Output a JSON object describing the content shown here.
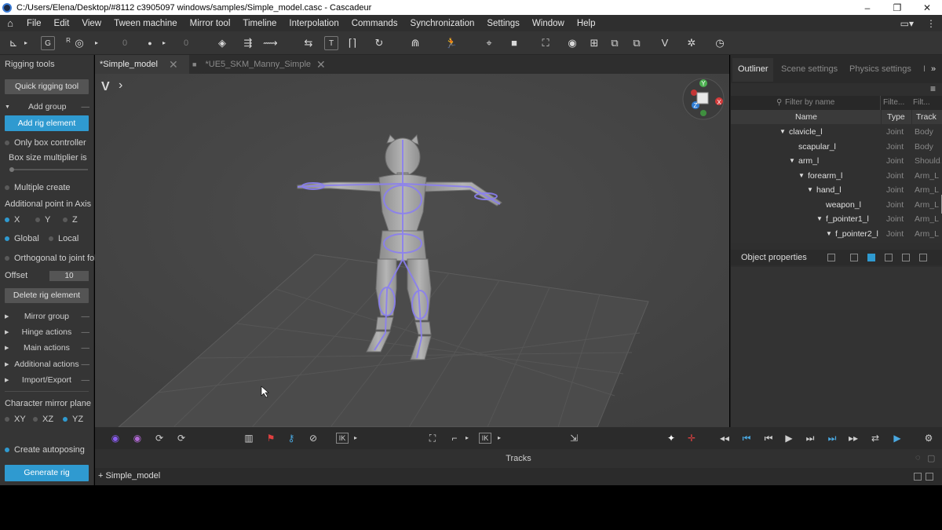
{
  "window": {
    "title": "C:/Users/Elena/Desktop/#8112 c3905097 windows/samples/Simple_model.casc - Cascadeur",
    "minimize": "‒",
    "maximize": "❐",
    "close": "✕"
  },
  "menu": {
    "items": [
      "File",
      "Edit",
      "View",
      "Tween machine",
      "Mirror tool",
      "Timeline",
      "Interpolation",
      "Commands",
      "Synchronization",
      "Settings",
      "Window",
      "Help"
    ]
  },
  "toolbar": {
    "g_label": "G",
    "r_label": "R",
    "field1": "0",
    "field2": "0",
    "t_label": "T",
    "ik_label": "IK"
  },
  "left_panel": {
    "title": "Rigging tools",
    "quick_rigging": "Quick rigging tool",
    "add_group": "Add group",
    "add_rig_element": "Add rig element",
    "only_box_controller": "Only box controller",
    "box_size_label": "Box size multiplier is",
    "box_size_value": "1",
    "multiple_create": "Multiple create",
    "additional_point": "Additional point in Axis",
    "axis_x": "X",
    "axis_y": "Y",
    "axis_z": "Z",
    "global": "Global",
    "local": "Local",
    "orthogonal": "Orthogonal to joint fold",
    "offset_label": "Offset",
    "offset_value": "10",
    "delete_rig_element": "Delete rig element",
    "groups": [
      "Mirror group",
      "Hinge actions",
      "Main actions",
      "Additional actions",
      "Import/Export"
    ],
    "mirror_plane": "Character mirror plane",
    "plane_xy": "XY",
    "plane_xz": "XZ",
    "plane_yz": "YZ",
    "create_autoposing": "Create autoposing",
    "generate_rig": "Generate rig"
  },
  "tabs": {
    "tab1": "*Simple_model",
    "tab2": "*UE5_SKM_Manny_Simple"
  },
  "viewport": {
    "gizmo_y": "Y",
    "gizmo_x": "X",
    "gizmo_z": "Z"
  },
  "right_panel": {
    "tab_outliner": "Outliner",
    "tab_scene": "Scene settings",
    "tab_physics": "Physics settings",
    "tab_more": "I",
    "filter_placeholder": "Filter by name",
    "filter2": "Filte...",
    "filter3": "Filt...",
    "col_name": "Name",
    "col_type": "Type",
    "col_track": "Track",
    "tree": [
      {
        "name": "clavicle_l",
        "type": "Joint",
        "track": "Body",
        "arrow": "▼"
      },
      {
        "name": "scapular_l",
        "type": "Joint",
        "track": "Body",
        "arrow": ""
      },
      {
        "name": "arm_l",
        "type": "Joint",
        "track": "Should...",
        "arrow": "▼"
      },
      {
        "name": "forearm_l",
        "type": "Joint",
        "track": "Arm_L",
        "arrow": "▼"
      },
      {
        "name": "hand_l",
        "type": "Joint",
        "track": "Arm_L",
        "arrow": "▼"
      },
      {
        "name": "weapon_l",
        "type": "Joint",
        "track": "Arm_L",
        "arrow": ""
      },
      {
        "name": "f_pointer1_l",
        "type": "Joint",
        "track": "Arm_L",
        "arrow": "▼"
      },
      {
        "name": "f_pointer2_l",
        "type": "Joint",
        "track": "Arm_L",
        "arrow": "▼"
      }
    ],
    "object_properties": "Object properties"
  },
  "transport": {
    "ik_label": "IK"
  },
  "tracks": {
    "label": "Tracks",
    "row_name": "+ Simple_model"
  },
  "colors": {
    "accent_blue": "#2f9ad0",
    "panel_bg": "#353535",
    "viewport_bg": "#464646",
    "rig_purple": "#8a7ff0"
  }
}
